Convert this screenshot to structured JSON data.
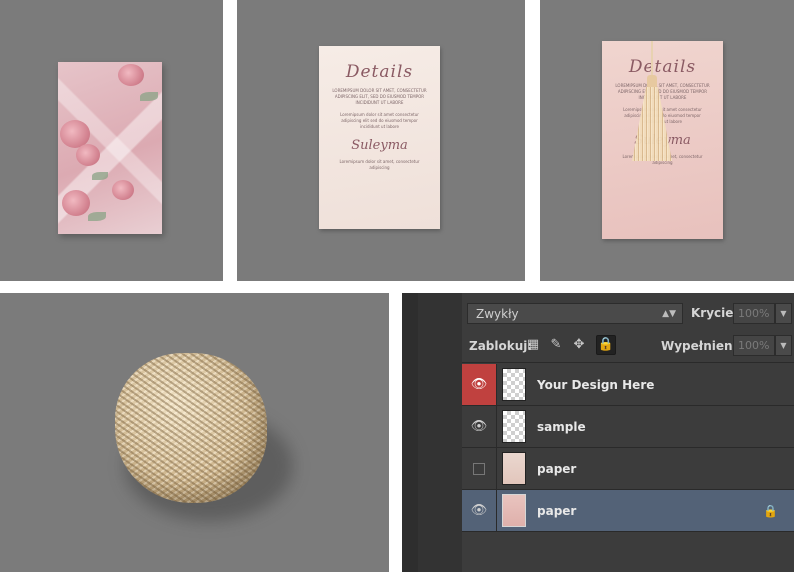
{
  "layers_panel": {
    "blend_mode": "Zwykły",
    "opacity_label": "Krycie:",
    "opacity_value": "100%",
    "lock_label": "Zablokuj:",
    "fill_label": "Wypełnienie:",
    "fill_value": "100%",
    "layers": [
      {
        "name": "Your Design Here",
        "visible": true,
        "selected": false,
        "locked": false
      },
      {
        "name": "sample",
        "visible": true,
        "selected": false,
        "locked": false
      },
      {
        "name": "paper",
        "visible": false,
        "selected": false,
        "locked": false
      },
      {
        "name": "paper",
        "visible": true,
        "selected": true,
        "locked": true
      }
    ]
  },
  "card": {
    "heading": "Details",
    "signature": "Suleyma",
    "body_text_1": "LOREMIPSUM DOLOR SIT AMET, CONSECTETUR ADIPISCING ELIT, SED DO EIUSMOD TEMPOR INCIDIDUNT UT LABORE",
    "body_text_2": "Loremipsum dolor sit amet consectetur adipiscing elit sed do eiusmod tempor incididunt ut labore",
    "footer_text": "Loremipsum dolor sit amet, consectetur adipiscing"
  },
  "colors": {
    "panel_bg": "#3c3c3c",
    "selected_row": "#536277",
    "visibility_active": "#c0413f",
    "tile_bg": "#7b7b7b"
  },
  "icons": {
    "eye": "eye-icon",
    "lock": "lock-icon",
    "transparency_lock": "checkerboard-icon",
    "brush_lock": "brush-icon",
    "move_lock": "move-icon"
  }
}
